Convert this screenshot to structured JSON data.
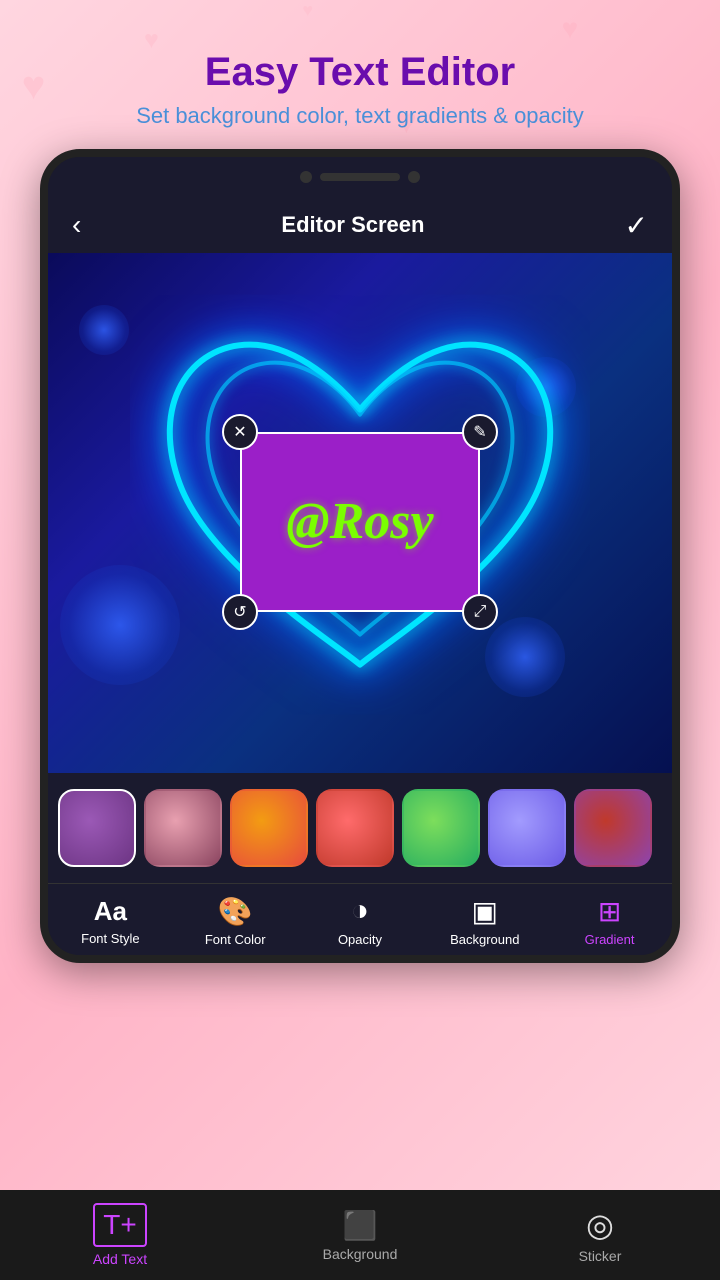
{
  "app": {
    "title": "Easy Text Editor",
    "subtitle": "Set background color, text gradients & opacity"
  },
  "editor": {
    "screen_title": "Editor Screen",
    "back_label": "‹",
    "check_label": "✓",
    "canvas_text": "@Rosy"
  },
  "color_swatches": [
    {
      "id": 1,
      "gradient": "radial-gradient(circle at 40% 40%, #9b59b6, #6c3483)",
      "active": true
    },
    {
      "id": 2,
      "gradient": "radial-gradient(circle at 40% 40%, #e8a0b0, #8b4560)",
      "active": false
    },
    {
      "id": 3,
      "gradient": "radial-gradient(circle at 40% 40%, #f39c12, #e74c3c)",
      "active": false
    },
    {
      "id": 4,
      "gradient": "radial-gradient(circle at 40% 40%, #ff6b6b, #c0392b)",
      "active": false
    },
    {
      "id": 5,
      "gradient": "radial-gradient(circle at 40% 40%, #7dde5c, #27ae60)",
      "active": false
    },
    {
      "id": 6,
      "gradient": "radial-gradient(circle at 40% 40%, #a29bfe, #6c5ce7)",
      "active": false
    },
    {
      "id": 7,
      "gradient": "radial-gradient(circle at 40% 40%, #c0392b, #8e44ad)",
      "active": false
    }
  ],
  "tools": [
    {
      "id": "font_style",
      "label": "Font Style",
      "icon": "Aa",
      "active": false
    },
    {
      "id": "font_color",
      "label": "Font Color",
      "icon": "🎨",
      "active": false
    },
    {
      "id": "opacity",
      "label": "Opacity",
      "icon": "◑",
      "active": false
    },
    {
      "id": "background",
      "label": "Background",
      "icon": "▣",
      "active": false
    },
    {
      "id": "gradient",
      "label": "Gradient",
      "icon": "⊞",
      "active": true
    }
  ],
  "nav_items": [
    {
      "id": "add_text",
      "label": "Add Text",
      "icon": "T+",
      "active": true
    },
    {
      "id": "background",
      "label": "Background",
      "icon": "⬛",
      "active": false
    },
    {
      "id": "sticker",
      "label": "Sticker",
      "icon": "●",
      "active": false
    }
  ],
  "handles": {
    "close": "✕",
    "edit": "✎",
    "rotate": "↺",
    "expand": "⤢"
  }
}
